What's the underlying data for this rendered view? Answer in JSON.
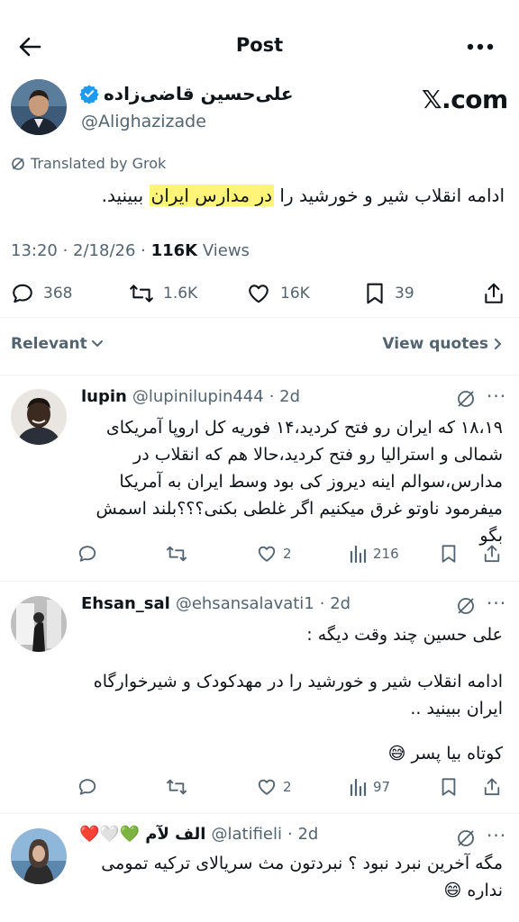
{
  "header": {
    "title": "Post"
  },
  "post": {
    "author_name": "علی‌حسین قاضی‌زاده",
    "handle": "@Alighazizade",
    "brand": "𝕏.com",
    "translated_label": "Translated by Grok",
    "text_pre": "ادامه انقلاب شیر و خورشید را ",
    "text_hl": "در مدارس ایران",
    "text_post": " ببینید.",
    "time": "13:20 · 2/18/26 · ",
    "views_count": "116K",
    "views_label": " Views",
    "stats": {
      "replies": "368",
      "reposts": "1.6K",
      "likes": "16K",
      "bookmarks": "39"
    }
  },
  "sort": {
    "relevant": "Relevant",
    "view_quotes": "View quotes"
  },
  "replies": [
    {
      "name": "lupin",
      "handle": "@lupinilupin444",
      "age": "· 2d",
      "text": "۱۸،۱۹ که ایران رو فتح کردید،۱۴ فوریه کل اروپا آمریکای شمالی و استرالیا رو فتح کردید،حالا هم که انقلاب در مدارس،سوالم اینه دیروز کی بود وسط ایران به آمریکا میفرمود ناوتو غرق میکنیم اگر غلطی بکنی؟؟؟بلند اسمش بگو",
      "likes": "2",
      "views": "216"
    },
    {
      "name": "Ehsan_sal",
      "handle": "@ehsansalavati1",
      "age": "· 2d",
      "text1": "علی حسین چند وقت دیگه :",
      "text2": "ادامه انقلاب شیر و خورشید را در مهدکودک و شیرخوارگاه ایران ببینید ..",
      "text3": "کوتاه بیا پسر 😅",
      "likes": "2",
      "views": "97"
    },
    {
      "name": "الف لآم",
      "name_emoji": "❤️🤍💚",
      "handle": "@latifieli",
      "age": "· 2d",
      "text": "مگه آخرین نبرد نبود ؟ نبردتون مث سریالای ترکیه تمومی نداره 😄"
    }
  ],
  "colors": {
    "accent": "#1d9bf0",
    "muted": "#536471",
    "highlight": "#fff47a"
  }
}
